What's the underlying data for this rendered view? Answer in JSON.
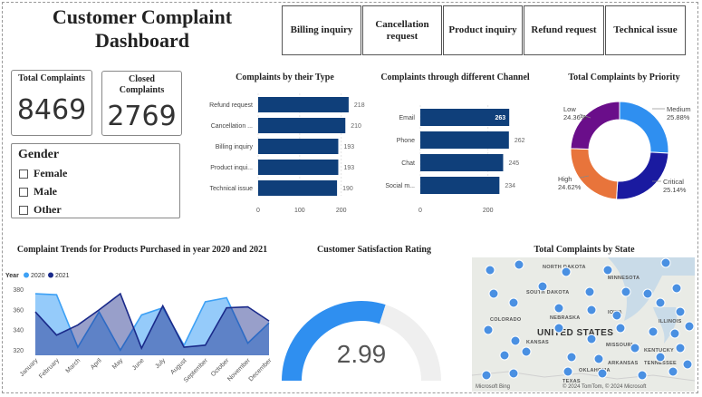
{
  "dashboard": {
    "title": "Customer Complaint Dashboard"
  },
  "slicers": [
    {
      "label": "Billing inquiry"
    },
    {
      "label": "Cancellation request"
    },
    {
      "label": "Product inquiry"
    },
    {
      "label": "Refund request"
    },
    {
      "label": "Technical issue"
    }
  ],
  "kpis": {
    "total": {
      "label": "Total Complaints",
      "value": "8469"
    },
    "closed": {
      "label": "Closed Complaints",
      "value": "2769"
    }
  },
  "gender": {
    "title": "Gender",
    "options": [
      "Female",
      "Male",
      "Other"
    ]
  },
  "colors": {
    "bar": "#0f3f7a",
    "medium": "#2f8ff0",
    "critical": "#1a1aa0",
    "high": "#e8743b",
    "low": "#6a0e8a",
    "y2020": "#3ea1f5",
    "y2021": "#1a2a8a",
    "gauge": "#2f8ff0"
  },
  "charts": {
    "by_type": {
      "title": "Complaints by their Type",
      "type": "bar",
      "categories": [
        "Refund request",
        "Cancellation ...",
        "Billing inquiry",
        "Product inqui...",
        "Technical issue"
      ],
      "values": [
        218,
        210,
        193,
        193,
        190
      ],
      "xticks": [
        "0",
        "100",
        "200"
      ],
      "xlim": [
        0,
        240
      ]
    },
    "by_channel": {
      "title": "Complaints through different Channel",
      "type": "bar",
      "categories": [
        "Email",
        "Phone",
        "Chat",
        "Social m..."
      ],
      "values": [
        263,
        262,
        245,
        234
      ],
      "xticks": [
        "0",
        "200"
      ],
      "xlim": [
        0,
        300
      ]
    },
    "by_priority": {
      "title": "Total Complaints by Priority",
      "type": "pie",
      "slices": [
        {
          "name": "Medium",
          "pct": "25.88%",
          "value": 25.88
        },
        {
          "name": "Critical",
          "pct": "25.14%",
          "value": 25.14
        },
        {
          "name": "High",
          "pct": "24.62%",
          "value": 24.62
        },
        {
          "name": "Low",
          "pct": "24.36%",
          "value": 24.36
        }
      ]
    },
    "trends": {
      "title": "Complaint Trends for Products Purchased in year 2020 and 2021",
      "type": "area",
      "legend_title": "Year",
      "categories": [
        "January",
        "February",
        "March",
        "April",
        "May",
        "June",
        "July",
        "August",
        "September",
        "October",
        "November",
        "December"
      ],
      "series": [
        {
          "name": "2020",
          "values": [
            376,
            375,
            323,
            358,
            320,
            355,
            362,
            325,
            368,
            372,
            327,
            347
          ]
        },
        {
          "name": "2021",
          "values": [
            358,
            335,
            345,
            360,
            376,
            322,
            364,
            323,
            325,
            362,
            363,
            349
          ]
        }
      ],
      "yticks": [
        "380",
        "360",
        "340",
        "320"
      ],
      "ylim": [
        315,
        385
      ]
    },
    "satisfaction": {
      "title": "Customer Satisfaction Rating",
      "type": "gauge",
      "value": 2.99,
      "display": "2.99",
      "max": 5
    },
    "by_state": {
      "title": "Total Complaints by State",
      "labels": [
        "NORTH DAKOTA",
        "MINNESOTA",
        "SOUTH DAKOTA",
        "NEBRASKA",
        "IOWA",
        "KANSAS",
        "MISSOURI",
        "OKLAHOMA",
        "ILLINOIS",
        "KENTUCKY",
        "TENNESSEE",
        "ARKANSAS",
        "COLORADO",
        "TEXAS",
        "UNITED STATES"
      ],
      "credit": "© 2024 TomTom, © 2024 Microsoft",
      "brand": "Microsoft Bing"
    }
  }
}
